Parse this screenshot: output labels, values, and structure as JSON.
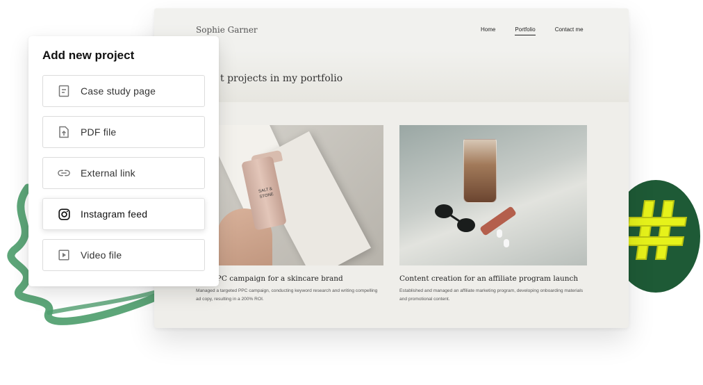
{
  "panel": {
    "title": "Add new project",
    "options": [
      {
        "label": "Case study page",
        "icon": "document-icon"
      },
      {
        "label": "PDF file",
        "icon": "file-upload-icon"
      },
      {
        "label": "External link",
        "icon": "link-icon"
      },
      {
        "label": "Instagram feed",
        "icon": "instagram-icon"
      },
      {
        "label": "Video file",
        "icon": "play-icon"
      }
    ]
  },
  "site": {
    "brand": "Sophie Garner",
    "nav": [
      {
        "label": "Home",
        "active": false
      },
      {
        "label": "Portfolio",
        "active": true
      },
      {
        "label": "Contact me",
        "active": false
      }
    ],
    "headline": "t projects in my portfolio",
    "cards": [
      {
        "title": "sful PPC campaign for a skincare brand",
        "desc": "Managed a targeted PPC campaign, conducting keyword research and writing compelling ad copy, resulting in a 200% ROI.",
        "product_label": "SALT & STONE"
      },
      {
        "title": "Content creation for an affiliate program launch",
        "desc": "Established and managed an affiliate marketing program, developing onboarding materials and promotional content."
      }
    ]
  },
  "colors": {
    "badge": "#1e5a36",
    "badge_accent": "#e6f21a",
    "scribble": "#4f9e6e",
    "site_bg": "#efeeea"
  }
}
